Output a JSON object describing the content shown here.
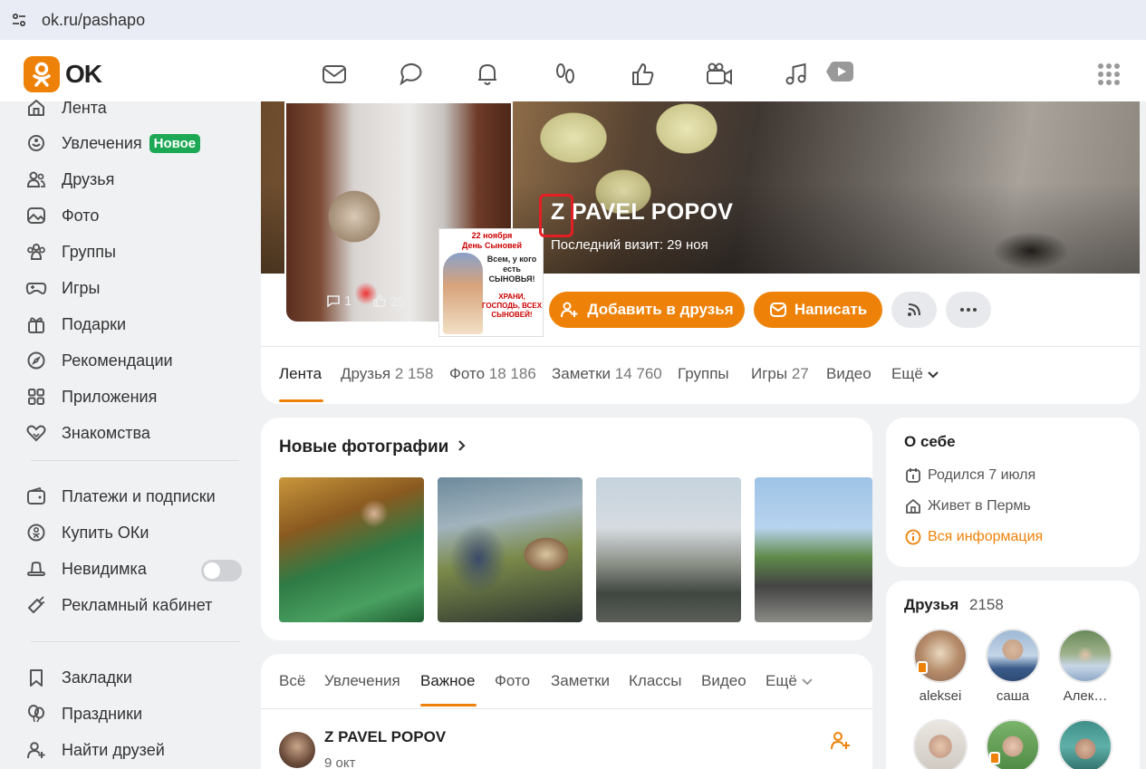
{
  "browser": {
    "url": "ok.ru/pashapo"
  },
  "brand": {
    "logo_text": "OK",
    "accent": "#ee8208",
    "green": "#1ca854"
  },
  "topnav": {
    "icons": [
      "mail-icon",
      "chat-icon",
      "bell-icon",
      "footprints-icon",
      "thumbs-up-icon",
      "video-camera-icon",
      "music-note-icon",
      "play-icon",
      "apps-grid-icon"
    ]
  },
  "sidebar": {
    "items": [
      {
        "label": "Лента",
        "icon": "home-icon"
      },
      {
        "label": "Увлечения",
        "icon": "hobby-icon",
        "badge": "Новое"
      },
      {
        "label": "Друзья",
        "icon": "friends-icon"
      },
      {
        "label": "Фото",
        "icon": "photo-icon"
      },
      {
        "label": "Группы",
        "icon": "groups-icon"
      },
      {
        "label": "Игры",
        "icon": "gamepad-icon"
      },
      {
        "label": "Подарки",
        "icon": "gift-icon"
      },
      {
        "label": "Рекомендации",
        "icon": "compass-icon"
      },
      {
        "label": "Приложения",
        "icon": "apps-icon"
      },
      {
        "label": "Знакомства",
        "icon": "hearts-icon"
      }
    ],
    "items2": [
      {
        "label": "Платежи и подписки",
        "icon": "wallet-icon"
      },
      {
        "label": "Купить ОКи",
        "icon": "coin-icon"
      },
      {
        "label": "Невидимка",
        "icon": "hat-icon",
        "toggle": false
      },
      {
        "label": "Рекламный кабинет",
        "icon": "megaphone-icon"
      }
    ],
    "items3": [
      {
        "label": "Закладки",
        "icon": "bookmark-icon"
      },
      {
        "label": "Праздники",
        "icon": "balloons-icon"
      },
      {
        "label": "Найти друзей",
        "icon": "add-person-icon"
      }
    ]
  },
  "profile": {
    "name_prefix": "Z",
    "name_rest": "PAVEL POPOV",
    "last_visit": "Последний визит: 29 ноя",
    "avatar_comments": "1",
    "avatar_likes": "25",
    "card_post": {
      "title": "22 ноября\nДень Сыновей",
      "text": "Всем, у кого есть СЫНОВЬЯ!",
      "wish": "ХРАНИ, ГОСПОДЬ, ВСЕХ СЫНОВЕЙ!"
    },
    "add_friend_label": "Добавить в друзья",
    "write_label": "Написать",
    "tabs": [
      {
        "label": "Лента",
        "count": ""
      },
      {
        "label": "Друзья",
        "count": "2 158"
      },
      {
        "label": "Фото",
        "count": "18 186"
      },
      {
        "label": "Заметки",
        "count": "14 760"
      },
      {
        "label": "Группы",
        "count": ""
      },
      {
        "label": "Игры",
        "count": "27"
      },
      {
        "label": "Видео",
        "count": ""
      },
      {
        "label": "Ещё",
        "count": ""
      }
    ]
  },
  "photos": {
    "title": "Новые фотографии"
  },
  "feed": {
    "tabs": [
      "Всё",
      "Увлечения",
      "Важное",
      "Фото",
      "Заметки",
      "Классы",
      "Видео",
      "Ещё"
    ],
    "active_tab": "Важное",
    "post": {
      "author": "Z PAVEL POPOV",
      "date": "9 окт"
    }
  },
  "about": {
    "title": "О себе",
    "born": "Родился 7 июля",
    "lives": "Живет в Пермь",
    "all_info": "Вся информация"
  },
  "friends": {
    "title": "Друзья",
    "count": "2158",
    "list": [
      {
        "name": "aleksei"
      },
      {
        "name": "саша"
      },
      {
        "name": "Алек…"
      }
    ]
  }
}
